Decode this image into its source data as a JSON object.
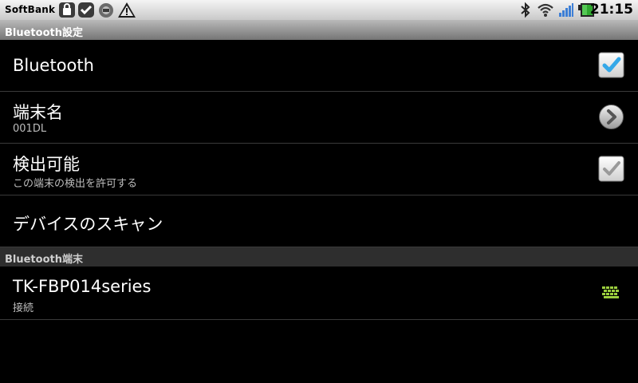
{
  "status_bar": {
    "carrier": "SoftBank",
    "time": "21:15",
    "icons": [
      "lock-bag-icon",
      "check-badge-icon",
      "usb-disc-icon",
      "warning-icon",
      "bluetooth-icon",
      "wifi-icon",
      "signal-icon",
      "battery-icon"
    ]
  },
  "title_bar": {
    "title": "Bluetooth設定"
  },
  "settings": {
    "bluetooth": {
      "title": "Bluetooth",
      "checked": true
    },
    "device_name": {
      "title": "端末名",
      "summary": "001DL"
    },
    "discoverable": {
      "title": "検出可能",
      "summary": "この端末の検出を許可する",
      "checked": false
    },
    "scan": {
      "title": "デバイスのスキャン"
    }
  },
  "paired_section": {
    "header": "Bluetooth端末",
    "devices": [
      {
        "name": "TK-FBP014series",
        "status": "接続",
        "icon": "keyboard-icon"
      }
    ]
  },
  "colors": {
    "accent_check": "#35a8e8",
    "list_divider": "#3a3a3a",
    "section_bg": "#2e2e2e",
    "keyboard_icon": "#9ccf3e"
  }
}
